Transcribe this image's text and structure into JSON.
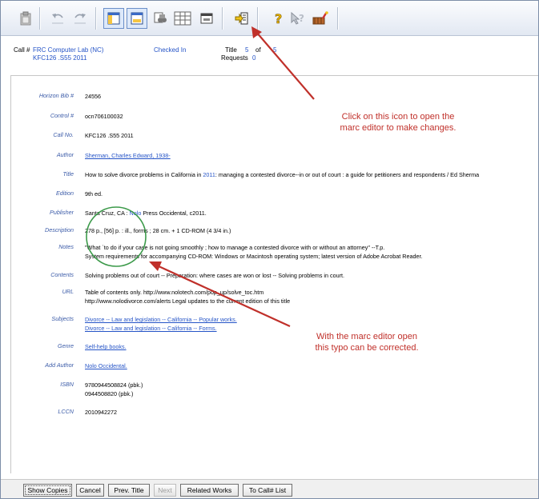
{
  "toolbar": {
    "buttons": [
      {
        "name": "clipboard-icon",
        "active": false
      },
      {
        "name": "undo-icon",
        "active": false
      },
      {
        "name": "redo-icon",
        "active": false
      },
      {
        "name": "record-view-icon",
        "active": true
      },
      {
        "name": "summary-view-icon",
        "active": true
      },
      {
        "name": "binoculars-icon",
        "active": false
      },
      {
        "name": "grid-view-icon",
        "active": false
      },
      {
        "name": "window-icon",
        "active": false
      },
      {
        "name": "marc-editor-icon",
        "active": false
      },
      {
        "name": "help-icon",
        "active": false
      },
      {
        "name": "context-help-icon",
        "active": false
      },
      {
        "name": "tools-icon",
        "active": false
      }
    ]
  },
  "header": {
    "call_label": "Call #",
    "location": "FRC Computer Lab (NC)",
    "call_number": "KFC126 .S55 2011",
    "status": "Checked In",
    "title_label": "Title",
    "title_index": "5",
    "of_label": "of",
    "title_total": "5",
    "requests_label": "Requests",
    "requests_count": "0"
  },
  "record": {
    "horizon_bib_label": "Horizon Bib #",
    "horizon_bib": "24556",
    "control_label": "Control #",
    "control": "ocn706100032",
    "callno_label": "Call No.",
    "callno": "KFC126 .S55 2011",
    "author_label": "Author",
    "author": "Sherman, Charles Edward, 1938-",
    "title_label": "Title",
    "title_pre": "How to solve divorce problems in California in ",
    "title_year": "2011",
    "title_post": ": managing a contested divorce--in or out of court : a guide for petitioners and respondents / Ed Sherma",
    "edition_label": "Edition",
    "edition": "9th ed.",
    "publisher_label": "Publisher",
    "publisher_pre": "Santa Cruz, CA : ",
    "publisher_link": "Nolo",
    "publisher_post": " Press Occidental, c2011.",
    "description_label": "Description",
    "description": "278 p., [56] p. : ill., forms ; 28 cm. + 1 CD-ROM (4 3/4 in.)",
    "notes_label": "Notes",
    "notes_1": "\"What `to do if your case is not going smoothly ; how to manage a contested divorce with or without an attorney\" --T.p.",
    "notes_2": "System requirements for accompanying CD-ROM: Windows or Macintosh operating system; latest version of Adobe Acrobat Reader.",
    "contents_label": "Contents",
    "contents": "Solving problems out of court -- Preparation: where cases are won or lost -- Solving problems in court.",
    "url_label": "URL",
    "url_1": "Table of contents only. http://www.nolotech.com/pop_up/solve_toc.htm",
    "url_2": "http://www.nolodivorce.com/alerts Legal updates to the current edition of this title",
    "subjects_label": "Subjects",
    "subject_1": "Divorce -- Law and legislation -- California -- Popular works.",
    "subject_2": "Divorce -- Law and legislation -- California -- Forms.",
    "genre_label": "Genre",
    "genre": "Self-help books.",
    "add_author_label": "Add Author",
    "add_author": "Nolo Occidental.",
    "isbn_label": "ISBN",
    "isbn_1": "9780944508824 (pbk.)",
    "isbn_2": "0944508820 (pbk.)",
    "lccn_label": "LCCN",
    "lccn": "2010942272"
  },
  "annotations": {
    "icon_note_1": "Click on this icon  to open the",
    "icon_note_2": "marc editor to make changes.",
    "typo_note_1": "With the marc editor open",
    "typo_note_2": "this typo can be corrected.",
    "arrow_color": "#c0302a",
    "circle_color": "#3c9a4a"
  },
  "bottom": {
    "show_copies": "Show Copies",
    "cancel": "Cancel",
    "prev_title": "Prev. Title",
    "next": "Next",
    "related_works": "Related Works",
    "to_call_list": "To Call# List"
  }
}
